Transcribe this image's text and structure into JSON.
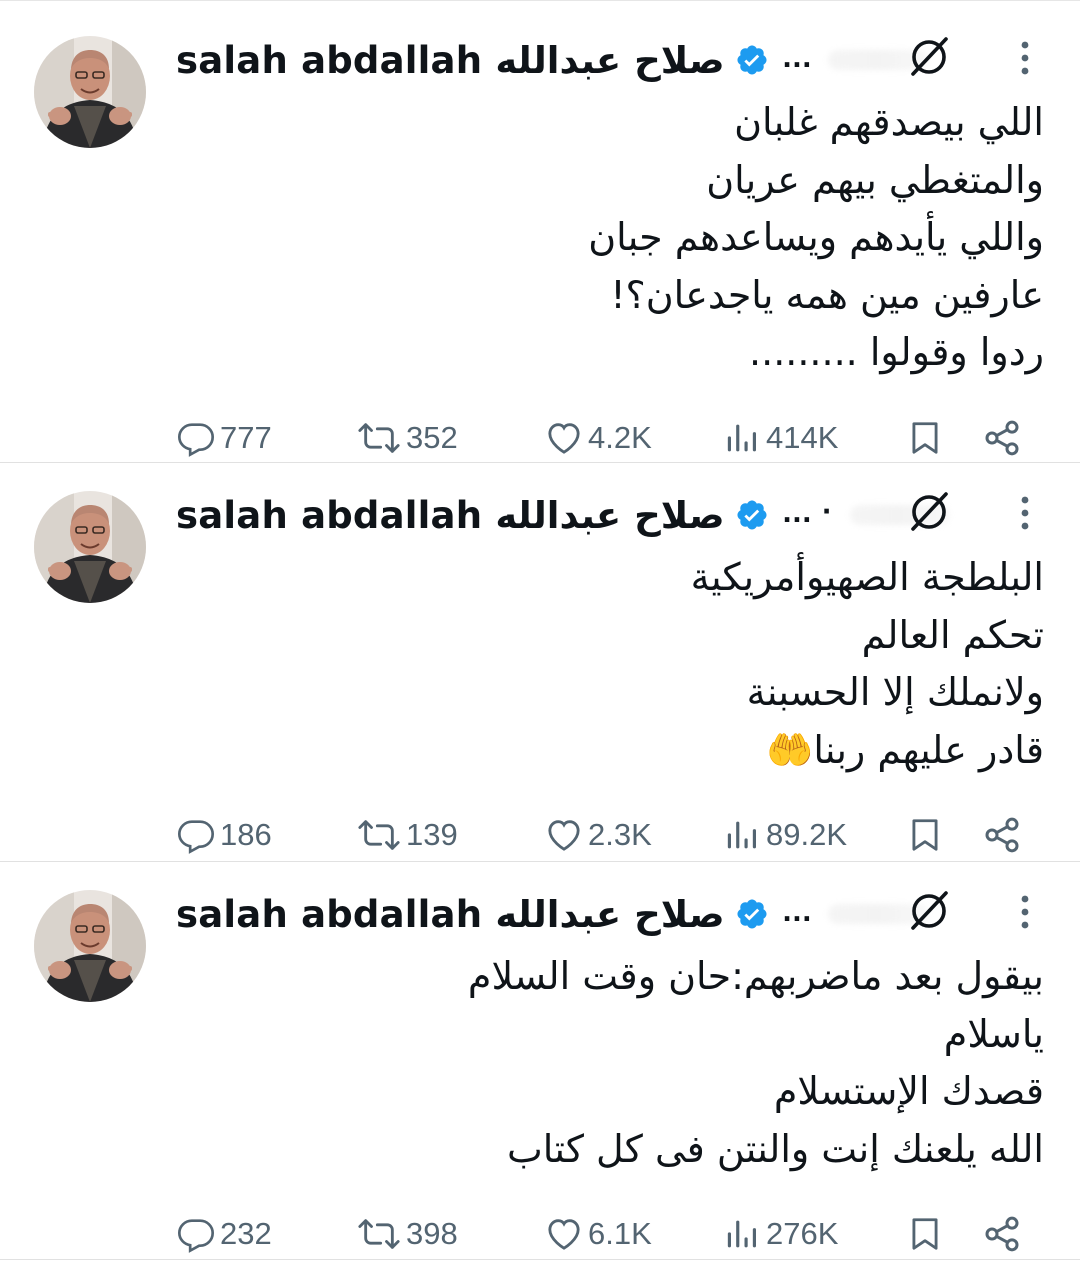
{
  "tweets": [
    {
      "author": {
        "name": "salah abdallah صلاح عبدالله",
        "more_indicator": "..."
      },
      "lines": [
        "اللي بيصدقهم غلبان",
        "والمتغطي بيهم عريان",
        "واللي يأيدهم ويساعدهم جبان",
        "عارفين مين همه ياجدعان؟!",
        "ردوا وقولوا ........."
      ],
      "stats": {
        "replies": "777",
        "reposts": "352",
        "likes": "4.2K",
        "views": "414K"
      }
    },
    {
      "author": {
        "name": "salah abdallah صلاح عبدالله",
        "more_indicator": "... ·"
      },
      "lines": [
        "البلطجة الصهيوأمريكية",
        "تحكم العالم",
        "ولانملك إلا الحسبنة",
        "قادر عليهم ربنا🤲"
      ],
      "stats": {
        "replies": "186",
        "reposts": "139",
        "likes": "2.3K",
        "views": "89.2K"
      }
    },
    {
      "author": {
        "name": "salah abdallah صلاح عبدالله",
        "more_indicator": "..."
      },
      "lines": [
        "بيقول بعد ماضربهم:حان وقت السلام",
        "ياسلام",
        "قصدك الإستسلام",
        "الله يلعنك إنت والنتن فى كل كتاب"
      ],
      "stats": {
        "replies": "232",
        "reposts": "398",
        "likes": "6.1K",
        "views": "276K"
      }
    }
  ],
  "colors": {
    "verified": "#1d9bf0",
    "text": "#0f1419",
    "muted": "#536471"
  },
  "icons": [
    "grok-icon",
    "more-vertical-icon",
    "reply-icon",
    "repost-icon",
    "like-icon",
    "views-icon",
    "bookmark-icon",
    "share-icon",
    "verified-badge-icon"
  ]
}
